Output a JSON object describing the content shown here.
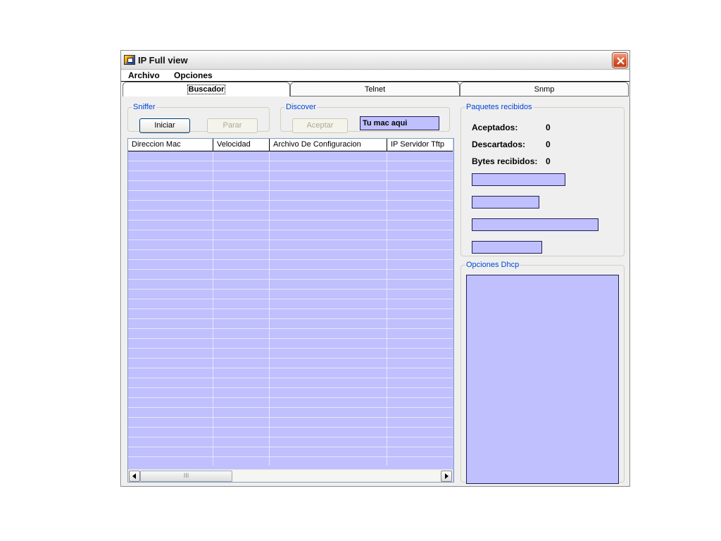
{
  "window": {
    "title": "IP Full view"
  },
  "menu": {
    "items": [
      "Archivo",
      "Opciones"
    ]
  },
  "tabs": [
    {
      "label": "Buscador",
      "active": true
    },
    {
      "label": "Telnet",
      "active": false
    },
    {
      "label": "Snmp",
      "active": false
    }
  ],
  "sniffer": {
    "legend": "Sniffer",
    "start_label": "Iniciar",
    "stop_label": "Parar",
    "stop_enabled": false
  },
  "discover": {
    "legend": "Discover",
    "accept_label": "Aceptar",
    "accept_enabled": false,
    "mac_value": "Tu mac aqui"
  },
  "table": {
    "columns": [
      "Direccion Mac",
      "Velocidad",
      "Archivo De Configuracion",
      "IP Servidor Tftp"
    ],
    "rows": []
  },
  "stats": {
    "legend": "Paquetes recibidos",
    "items": [
      {
        "label": "Aceptados:",
        "value": "0"
      },
      {
        "label": "Descartados:",
        "value": "0"
      },
      {
        "label": "Bytes recibidos:",
        "value": "0"
      }
    ]
  },
  "dhcp": {
    "legend": "Opciones Dhcp"
  },
  "scrollbar": {
    "thumb_grip": "III"
  },
  "colors": {
    "highlight_fill": "#c0c0ff",
    "legend_text": "#0046d5",
    "close_button": "#d9542b"
  }
}
